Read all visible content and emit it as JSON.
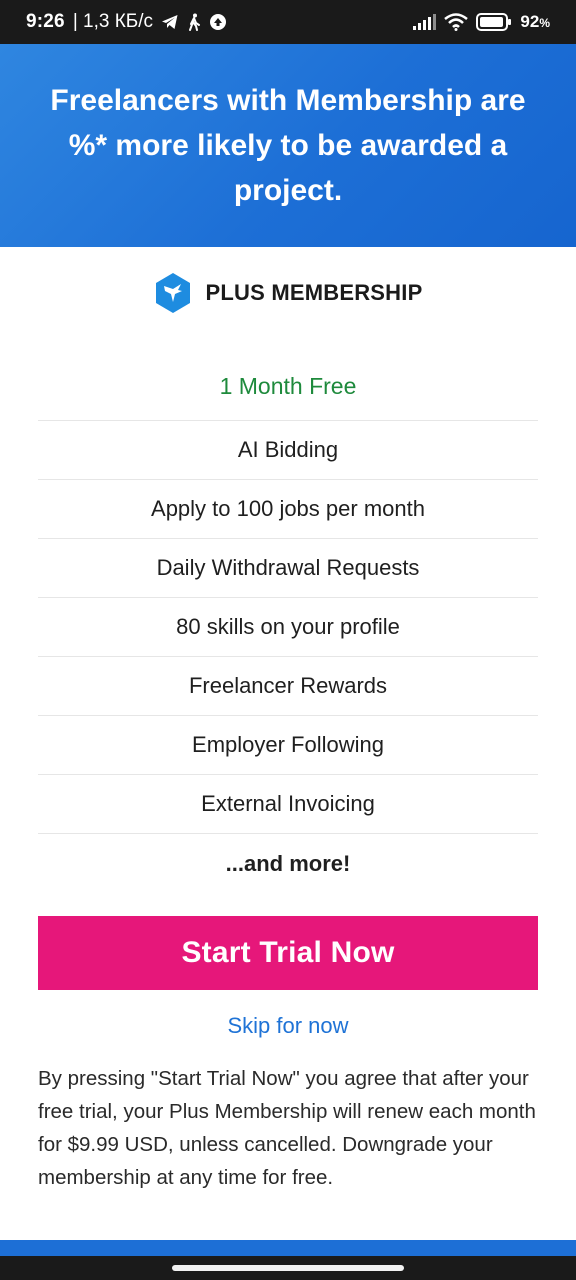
{
  "status_bar": {
    "time": "9:26",
    "network_speed": "| 1,3 КБ/с",
    "battery": "92",
    "battery_unit": "%",
    "icons": [
      "telegram-icon",
      "walking-person-icon",
      "sync-app-icon",
      "signal-icon",
      "wifi-icon",
      "battery-icon"
    ]
  },
  "hero": {
    "title": "Freelancers with Membership are %* more likely to be awarded a project."
  },
  "brand": {
    "logo_icon": "bird-hexagon-logo-icon",
    "label": "PLUS MEMBERSHIP"
  },
  "features": {
    "free_offer": "1 Month Free",
    "items": [
      "AI Bidding",
      "Apply to 100 jobs per month",
      "Daily Withdrawal Requests",
      "80 skills on your profile",
      "Freelancer Rewards",
      "Employer Following",
      "External Invoicing"
    ],
    "more": "...and more!"
  },
  "actions": {
    "start_trial": "Start Trial Now",
    "skip": "Skip for now"
  },
  "disclaimer": "By pressing \"Start Trial Now\" you agree that after your free trial, your Plus Membership will renew each month for $9.99 USD, unless cancelled. Downgrade your membership at any time for free.",
  "colors": {
    "hero_blue": "#1d6fd6",
    "cta_pink": "#e6177a",
    "free_green": "#1e8a3c",
    "link_blue": "#1f73d6"
  }
}
